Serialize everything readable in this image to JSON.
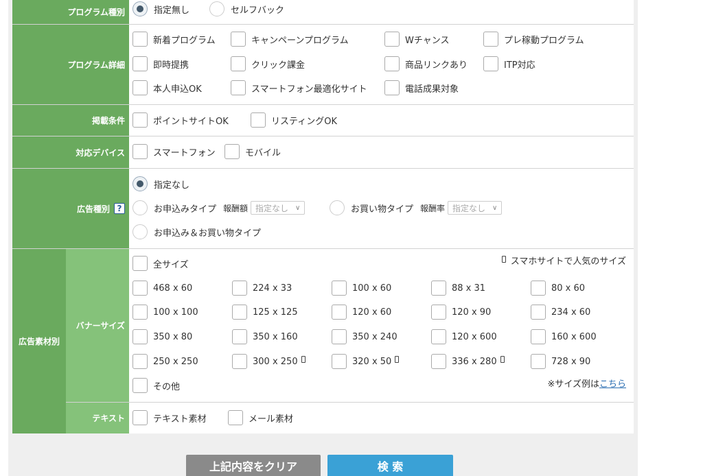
{
  "program_type": {
    "label": "プログラム種別",
    "options": [
      "指定無し",
      "セルフバック"
    ],
    "selected": "指定無し"
  },
  "program_detail": {
    "label": "プログラム詳細",
    "options": [
      "新着プログラム",
      "キャンペーンプログラム",
      "Wチャンス",
      "プレ稼動プログラム",
      "即時提携",
      "クリック課金",
      "商品リンクあり",
      "ITP対応",
      "本人申込OK",
      "スマートフォン最適化サイト",
      "電話成果対象"
    ]
  },
  "listing": {
    "label": "掲載条件",
    "options": [
      "ポイントサイトOK",
      "リスティングOK"
    ]
  },
  "device": {
    "label": "対応デバイス",
    "options": [
      "スマートフォン",
      "モバイル"
    ]
  },
  "ad_type": {
    "label": "広告種別",
    "help_icon": "?",
    "option_none": "指定なし",
    "option_apply": "お申込みタイプ",
    "fee_amount_label": "報酬額",
    "fee_amount_value": "指定なし",
    "option_shop": "お買い物タイプ",
    "fee_rate_label": "報酬率",
    "fee_rate_value": "指定なし",
    "option_both": "お申込み＆お買い物タイプ",
    "selected": "指定なし"
  },
  "material": {
    "label": "広告素材別",
    "banner_label": "バナーサイズ",
    "popular_note": "スマホサイトで人気のサイズ",
    "all_sizes": "全サイズ",
    "sizes": [
      "468 x 60",
      "224 x 33",
      "100 x 60",
      "88 x 31",
      "80 x 60",
      "100 x 100",
      "125 x 125",
      "120 x 60",
      "120 x 90",
      "234 x 60",
      "350 x 80",
      "350 x 160",
      "350 x 240",
      "120 x 600",
      "160 x 600",
      "250 x 250",
      "300 x 250",
      "320 x 50",
      "336 x 280",
      "728 x 90"
    ],
    "other": "その他",
    "example_prefix": "※サイズ例は",
    "example_link": "こちら",
    "text_label": "テキスト",
    "text_options": [
      "テキスト素材",
      "メール素材"
    ]
  },
  "buttons": {
    "clear": "上記内容をクリア",
    "search": "検 索"
  },
  "colors": {
    "label_green": "#6aaa5e",
    "sublabel_green": "#85c27a",
    "search_blue": "#3aa1d6",
    "clear_gray": "#8a8a8a"
  }
}
